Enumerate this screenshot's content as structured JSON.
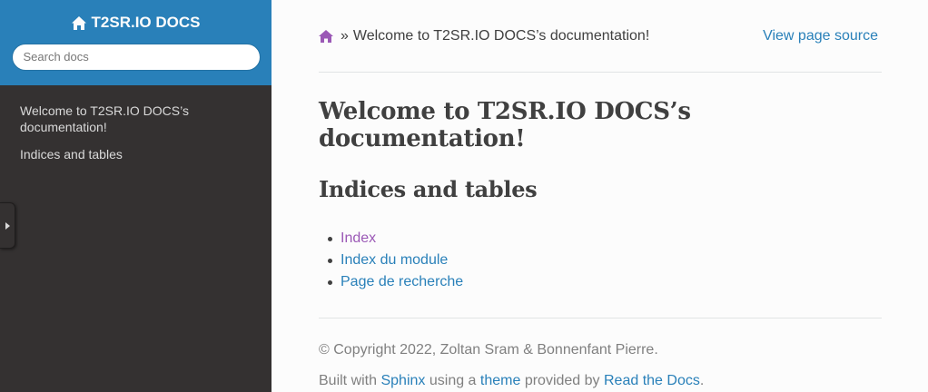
{
  "sidebar": {
    "project_title": "T2SR.IO DOCS",
    "search_placeholder": "Search docs",
    "nav_items": [
      {
        "label": "Welcome to T2SR.IO DOCS’s documentation!"
      },
      {
        "label": "Indices and tables"
      }
    ]
  },
  "breadcrumbs": {
    "separator": "»",
    "current": "Welcome to T2SR.IO DOCS’s documentation!",
    "view_source": "View page source"
  },
  "main": {
    "title": "Welcome to T2SR.IO DOCS’s documentation!",
    "section_heading": "Indices and tables",
    "links": [
      {
        "label": "Index"
      },
      {
        "label": "Index du module"
      },
      {
        "label": "Page de recherche"
      }
    ]
  },
  "footer": {
    "copyright": "© Copyright 2022, Zoltan Sram & Bonnenfant Pierre.",
    "built_with": "Built with",
    "sphinx": "Sphinx",
    "using_a": "using a",
    "theme": "theme",
    "provided_by": "provided by",
    "read_the_docs": "Read the Docs",
    "period": "."
  },
  "colors": {
    "accent": "#2980b9",
    "sidebar_bg": "#343131",
    "visited_link": "#9b59b6",
    "text": "#404040"
  },
  "icons": [
    "home-icon",
    "collapse-arrow-icon"
  ]
}
